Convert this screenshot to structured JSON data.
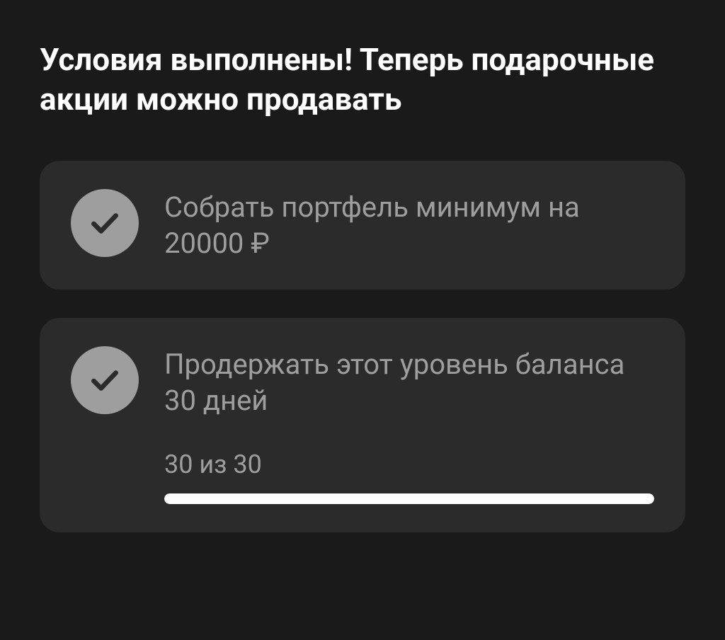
{
  "heading": "Условия выполнены! Теперь подарочные акции можно продавать",
  "conditions": [
    {
      "text": "Собрать портфель минимум на 20000 ₽",
      "completed": true
    },
    {
      "text": "Продержать этот уровень баланса 30 дней",
      "completed": true,
      "progress": {
        "label": "30 из 30",
        "current": 30,
        "total": 30
      }
    }
  ]
}
